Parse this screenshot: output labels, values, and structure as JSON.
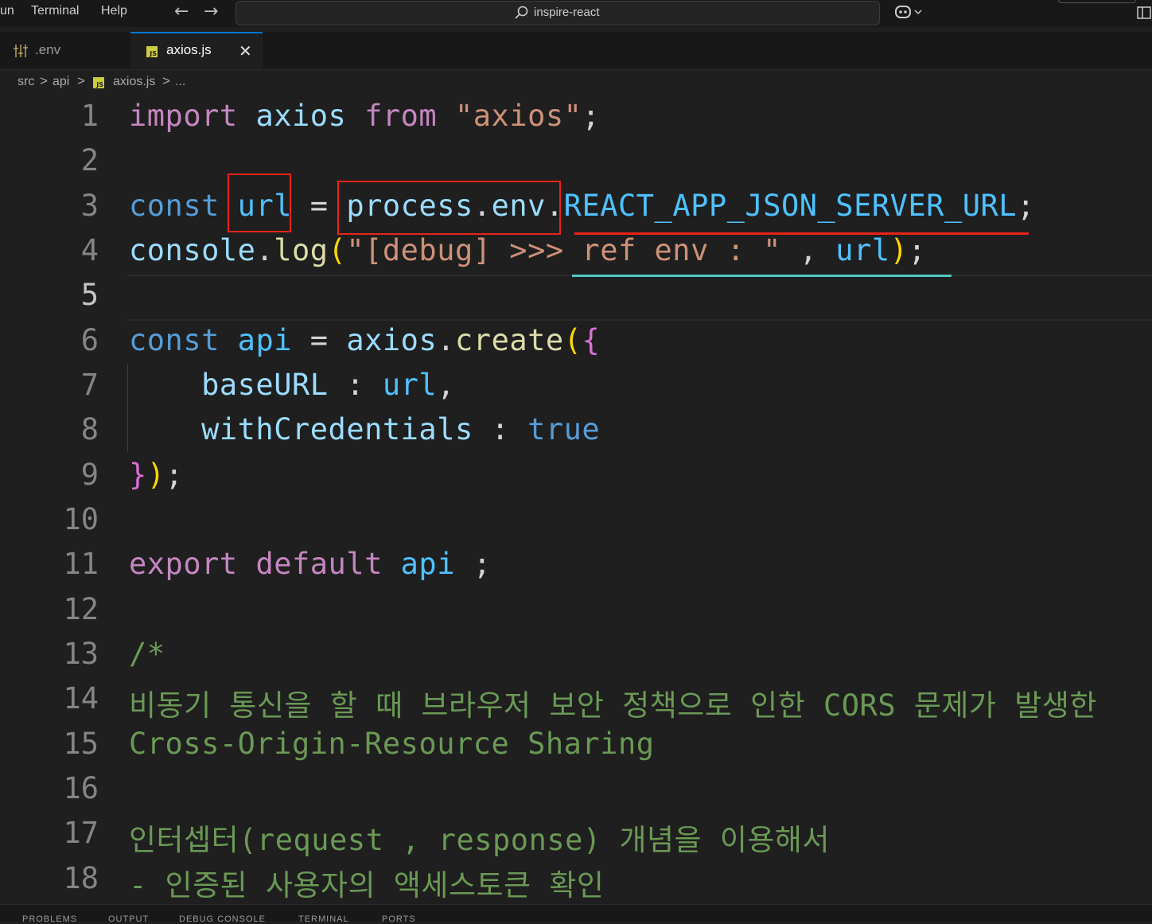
{
  "menu": {
    "run": "un",
    "terminal": "Terminal",
    "help": "Help"
  },
  "nav": {
    "back": "←",
    "forward": "→"
  },
  "command_center": {
    "label": "inspire-react"
  },
  "tabs": [
    {
      "label": ".env",
      "icon": "settings-file-icon",
      "active": false
    },
    {
      "label": "axios.js",
      "icon": "js-file-icon",
      "active": true,
      "close": "✕"
    }
  ],
  "breadcrumb": {
    "items": [
      "src",
      "api",
      "axios.js",
      "..."
    ],
    "separator": ">"
  },
  "editor": {
    "line_numbers": [
      "1",
      "2",
      "3",
      "4",
      "5",
      "6",
      "7",
      "8",
      "9",
      "10",
      "11",
      "12",
      "13",
      "14",
      "15",
      "16",
      "17",
      "18"
    ],
    "active_line": "5",
    "lines": {
      "l1": {
        "import": "import",
        "axios": "axios",
        "from": "from",
        "str": "\"axios\"",
        "semi": ";"
      },
      "l3": {
        "const": "const",
        "url": "url",
        "eq": "=",
        "process": "process",
        "dot1": ".",
        "env": "env",
        "dot2": ".",
        "envvar": "REACT_APP_JSON_SERVER_URL",
        "semi": ";"
      },
      "l4": {
        "console": "console",
        "dot": ".",
        "log": "log",
        "paren": "(",
        "str": "\"[debug] >>> ref env : \"",
        "comma": " , ",
        "url": "url",
        "close": ")",
        "semi": ";"
      },
      "l6": {
        "const": "const",
        "api": "api",
        "eq": "=",
        "axios": "axios",
        "dot": ".",
        "create": "create",
        "paren": "(",
        "brace": "{"
      },
      "l7": {
        "key": "baseURL",
        "colon": " : ",
        "url": "url",
        "comma": ","
      },
      "l8": {
        "key": "withCredentials",
        "colon": " : ",
        "val": "true"
      },
      "l9": {
        "brace": "}",
        "paren": ")",
        "semi": ";"
      },
      "l11": {
        "export": "export",
        "default": "default",
        "api": "api",
        "semi": ";"
      },
      "l13": "/*",
      "l14": "비동기 통신을 할 때 브라우저 보안 정책으로 인한 CORS 문제가 발생한",
      "l15": "Cross-Origin-Resource Sharing",
      "l17": "인터셉터(request , response) 개념을 이용해서",
      "l18": "- 인증된 사용자의 액세스토큰 확인"
    }
  },
  "panel": {
    "tabs": [
      "PROBLEMS",
      "OUTPUT",
      "DEBUG CONSOLE",
      "TERMINAL",
      "PORTS"
    ]
  },
  "colors": {
    "background": "#1f1f1f",
    "annotation_red": "#e8231a",
    "annotation_cyan": "#4ec9c0",
    "accent": "#0078d4"
  }
}
